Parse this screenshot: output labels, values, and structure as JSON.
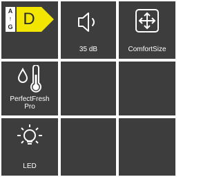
{
  "colors": {
    "tile_bg": "#3d3d3d",
    "grid_gap": "#ffffff",
    "energy_class_color": "#f2e600",
    "text": "#ffffff"
  },
  "tiles": [
    {
      "id": "energy-class",
      "scale_top": "A",
      "scale_arrow": "↑",
      "scale_bottom": "G",
      "energy_class": "D",
      "icon": "energy-label-icon"
    },
    {
      "id": "noise-level",
      "icon": "speaker-icon",
      "label": "35 dB"
    },
    {
      "id": "comfort-size",
      "icon": "move-arrows-icon",
      "label": "ComfortSize"
    },
    {
      "id": "perfect-fresh",
      "icon": "drop-thermometer-icon",
      "label_line1": "PerfectFresh",
      "label_line2": "Pro"
    },
    {
      "id": "empty-1"
    },
    {
      "id": "empty-2"
    },
    {
      "id": "led",
      "icon": "light-bulb-icon",
      "label": "LED"
    },
    {
      "id": "empty-3"
    },
    {
      "id": "empty-4"
    }
  ]
}
